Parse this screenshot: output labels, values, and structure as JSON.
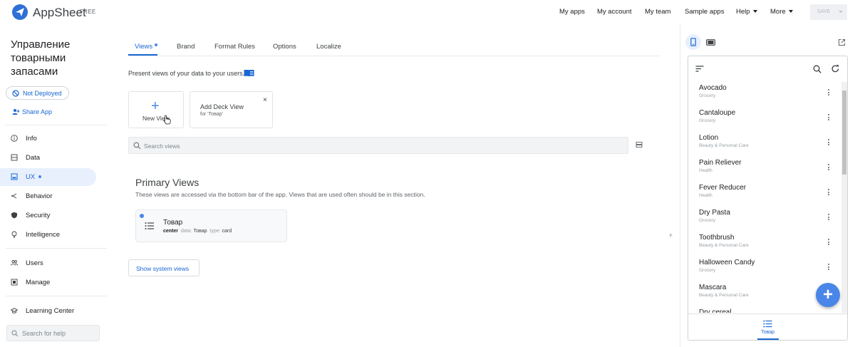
{
  "header": {
    "brand": "AppSheet",
    "brand_tag": "FREE",
    "nav": [
      "My apps",
      "My account",
      "My team",
      "Sample apps",
      "Help",
      "More"
    ],
    "save_label": "SAVE"
  },
  "sidebar": {
    "app_name": "Управление товарными запасами",
    "deploy_status": "Not Deployed",
    "share_label": "Share App",
    "items": [
      {
        "label": "Info",
        "icon": "info-icon"
      },
      {
        "label": "Data",
        "icon": "data-icon"
      },
      {
        "label": "UX",
        "icon": "ux-icon",
        "active": true
      },
      {
        "label": "Behavior",
        "icon": "behavior-icon"
      },
      {
        "label": "Security",
        "icon": "shield-icon"
      },
      {
        "label": "Intelligence",
        "icon": "bulb-icon"
      }
    ],
    "items2": [
      {
        "label": "Users",
        "icon": "users-icon"
      },
      {
        "label": "Manage",
        "icon": "manage-icon"
      }
    ],
    "learning_center": "Learning Center",
    "help_search_placeholder": "Search for help"
  },
  "main": {
    "tabs": [
      "Views",
      "Brand",
      "Format Rules",
      "Options",
      "Localize"
    ],
    "active_tab": "Views",
    "intro": "Present views of your data to your users.",
    "new_view_label": "New View",
    "suggestion": {
      "title": "Add Deck View",
      "subtitle": "for 'Товар'",
      "close": "×"
    },
    "search_placeholder": "Search views",
    "primary_title": "Primary Views",
    "primary_desc": "These views are accessed via the bottom bar of the app. Views that are used often should be in this section.",
    "view_card": {
      "name": "Товар",
      "position": "center",
      "data_key": "data:",
      "data_val": "Товар",
      "type_key": "type:",
      "type_val": "card"
    },
    "show_system_views": "Show system views"
  },
  "preview": {
    "items": [
      {
        "title": "Avocado",
        "category": "Grocery"
      },
      {
        "title": "Cantaloupe",
        "category": "Grocery"
      },
      {
        "title": "Lotion",
        "category": "Beauty & Personal Care"
      },
      {
        "title": "Pain Reliever",
        "category": "Health"
      },
      {
        "title": "Fever Reducer",
        "category": "Health"
      },
      {
        "title": "Dry Pasta",
        "category": "Grocery"
      },
      {
        "title": "Toothbrush",
        "category": "Beauty & Personal Care"
      },
      {
        "title": "Halloween Candy",
        "category": "Grocery"
      },
      {
        "title": "Mascara",
        "category": "Beauty & Personal Care"
      },
      {
        "title": "Dry cereal",
        "category": ""
      }
    ],
    "fab": "+",
    "bottom_nav_label": "Товар"
  },
  "colors": {
    "accent": "#1967d2",
    "active_bg": "#e8f0fe",
    "fab": "#4a86e8"
  }
}
